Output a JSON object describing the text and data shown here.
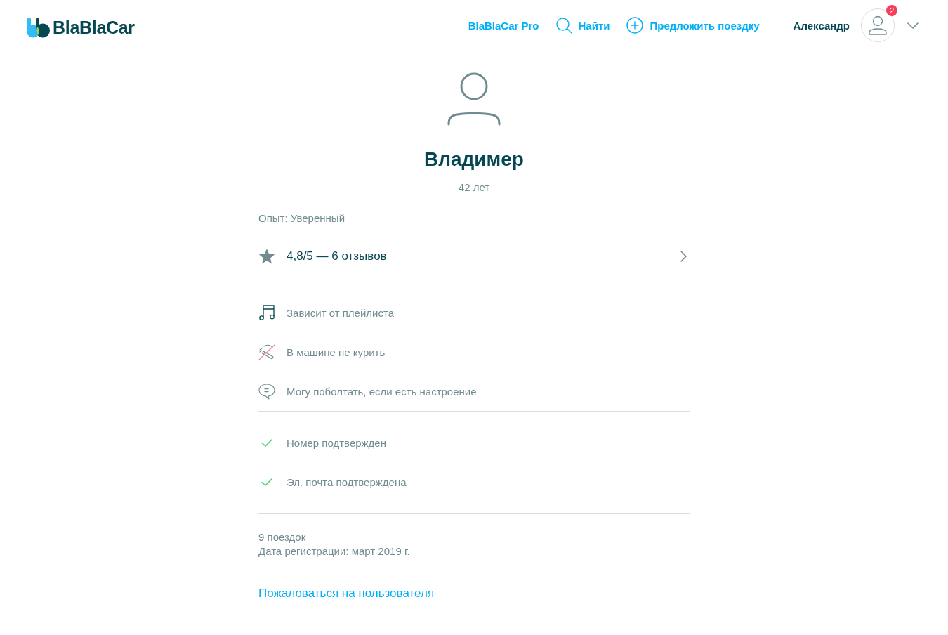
{
  "header": {
    "logo": "BlaBlaCar",
    "nav": [
      {
        "kind": "pro",
        "label": "BlaBlaCar Pro"
      },
      {
        "kind": "search",
        "label": "Найти"
      },
      {
        "kind": "offer",
        "label": "Предложить поездку"
      }
    ],
    "user": {
      "name": "Александр",
      "notifications": "2"
    }
  },
  "profile": {
    "name": "Владимер",
    "age": "42 лет",
    "experience": "Опыт: Уверенный",
    "rating": "4,8/5 — 6 отзывов",
    "preferences": [
      {
        "kind": "music",
        "text": "Зависит от плейлиста"
      },
      {
        "kind": "no_smoking",
        "text": "В машине не курить"
      },
      {
        "kind": "chat",
        "text": "Могу поболтать, если есть настроение"
      }
    ],
    "verifications": [
      {
        "text": "Номер подтвержден",
        "verified": true
      },
      {
        "text": "Эл. почта подтверждена",
        "verified": true
      }
    ],
    "stats": [
      "9 поездок",
      "Дата регистрации: март 2019 г."
    ],
    "report_link": "Пожаловаться на пользователя"
  }
}
